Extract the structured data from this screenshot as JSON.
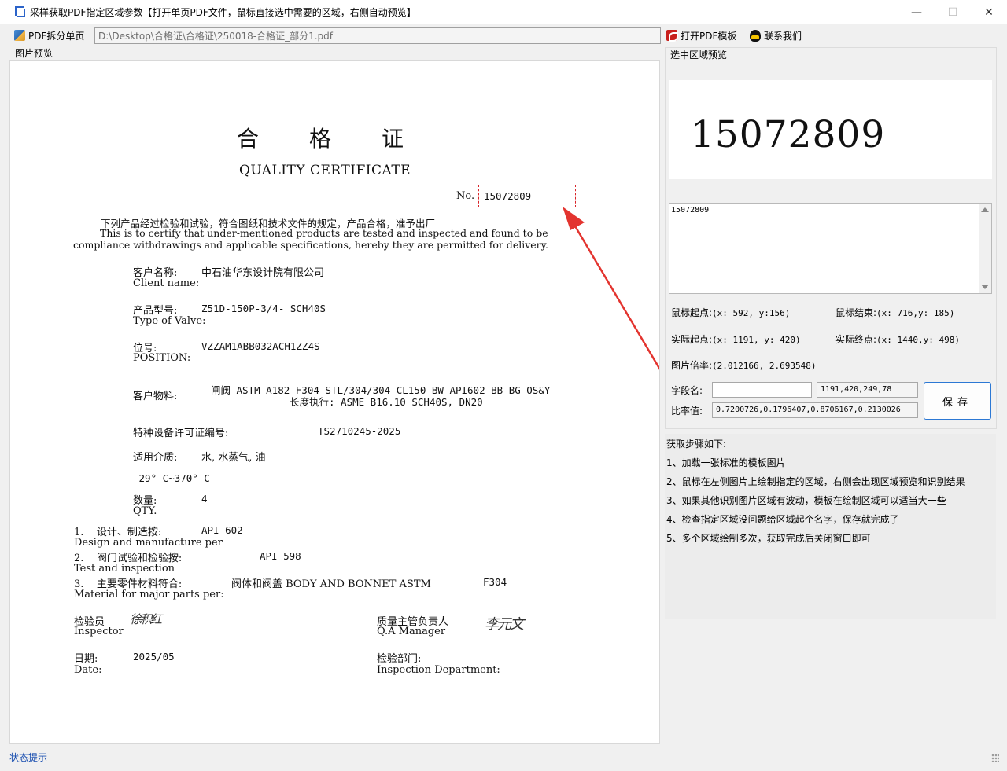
{
  "window": {
    "title": "采样获取PDF指定区域参数【打开单页PDF文件，鼠标直接选中需要的区域，右侧自动预览】",
    "minimize_icon": "minimize-icon",
    "maximize_icon": "maximize-icon",
    "close_icon": "close-icon"
  },
  "toolbar": {
    "split_label": "PDF拆分单页",
    "path_value": "D:\\Desktop\\合格证\\合格证\\250018-合格证_部分1.pdf",
    "open_template_label": "打开PDF模板",
    "contact_label": "联系我们"
  },
  "preview": {
    "label": "图片预览",
    "doc": {
      "cn_title": "合格证",
      "en_title": "QUALITY CERTIFICATE",
      "no_label": "No.",
      "no_value": "15072809",
      "intro_cn": "下列产品经过检验和试验，符合图纸和技术文件的规定，产品合格，准予出厂",
      "intro_en1": "This is to certify that under-mentioned products are tested and inspected and found to be",
      "intro_en2": "compliance withdrawings and applicable specifications, hereby they are permitted for delivery.",
      "client_cn": "客户名称:",
      "client_value": "中石油华东设计院有限公司",
      "client_en": "Client name:",
      "type_cn": "产品型号:",
      "type_value": "Z51D-150P-3/4- SCH40S",
      "type_en": "Type of Valve:",
      "pos_cn": "位号:",
      "pos_value": "VZZAM1ABB032ACH1ZZ4S",
      "pos_en": "POSITION:",
      "material_cn": "客户物料:",
      "material_value1": "闸阀 ASTM A182-F304 STL/304/304 CL150 BW API602 BB-BG-OS&Y",
      "material_value2": "长度执行: ASME B16.10 SCH40S, DN20",
      "license_cn": "特种设备许可证编号:",
      "license_value": "TS2710245-2025",
      "medium_cn": "适用介质:",
      "medium_value": "水, 水蒸气, 油",
      "temp_value": "-29° C~370° C",
      "qty_cn": "数量:",
      "qty_value": "4",
      "qty_en": "QTY.",
      "item1_cn": "1.    设计、制造按:",
      "item1_value": "API 602",
      "item1_en": "Design and manufacture per",
      "item2_cn": "2.    阀门试验和检验按:",
      "item2_value": "API 598",
      "item2_en": "Test and inspection",
      "item3_cn": "3.    主要零件材料符合:",
      "item3_value": "阀体和阀盖 BODY AND BONNET ASTM",
      "item3_value2": "F304",
      "item3_en": "Material for major parts per:",
      "inspector_cn": "检验员",
      "inspector_en": "Inspector",
      "inspector_sig": "徐积红",
      "qa_cn": "质量主管负责人",
      "qa_en": "Q.A Manager",
      "qa_sig": "李元文",
      "date_cn": "日期:",
      "date_value": "2025/05",
      "date_en": "Date:",
      "dept_cn": "检验部门:",
      "dept_en": "Inspection Department:"
    }
  },
  "selection": {
    "label": "选中区域预览",
    "crop_text": "15072809",
    "ocr_result": "15072809",
    "mouse_start_label": "鼠标起点:",
    "mouse_start_value": "(x: 592, y:156)",
    "mouse_end_label": "鼠标结束:",
    "mouse_end_value": "(x: 716,y: 185)",
    "actual_start_label": "实际起点:",
    "actual_start_value": "(x: 1191, y: 420)",
    "actual_end_label": "实际终点:",
    "actual_end_value": "(x: 1440,y: 498)",
    "scale_label": "图片倍率:",
    "scale_value": "(2.012166, 2.693548)",
    "field_name_label": "字段名:",
    "field_name_value": "",
    "rect_value": "1191,420,249,78",
    "ratio_label": "比率值:",
    "ratio_value": "0.7200726,0.1796407,0.8706167,0.2130026",
    "save_label": "保存"
  },
  "steps": {
    "title": "获取步骤如下:",
    "items": [
      "1、加载一张标准的模板图片",
      "2、鼠标在左侧图片上绘制指定的区域，右侧会出现区域预览和识别结果",
      "3、如果其他识别图片区域有波动，模板在绘制区域可以适当大一些",
      "4、检查指定区域没问题给区域起个名字，保存就完成了",
      "5、多个区域绘制多次，获取完成后关闭窗口即可"
    ]
  },
  "status": {
    "text": "状态提示"
  },
  "colors": {
    "accent": "#2c78d4",
    "selection": "#d9252a",
    "status_text": "#1a4fb0"
  }
}
